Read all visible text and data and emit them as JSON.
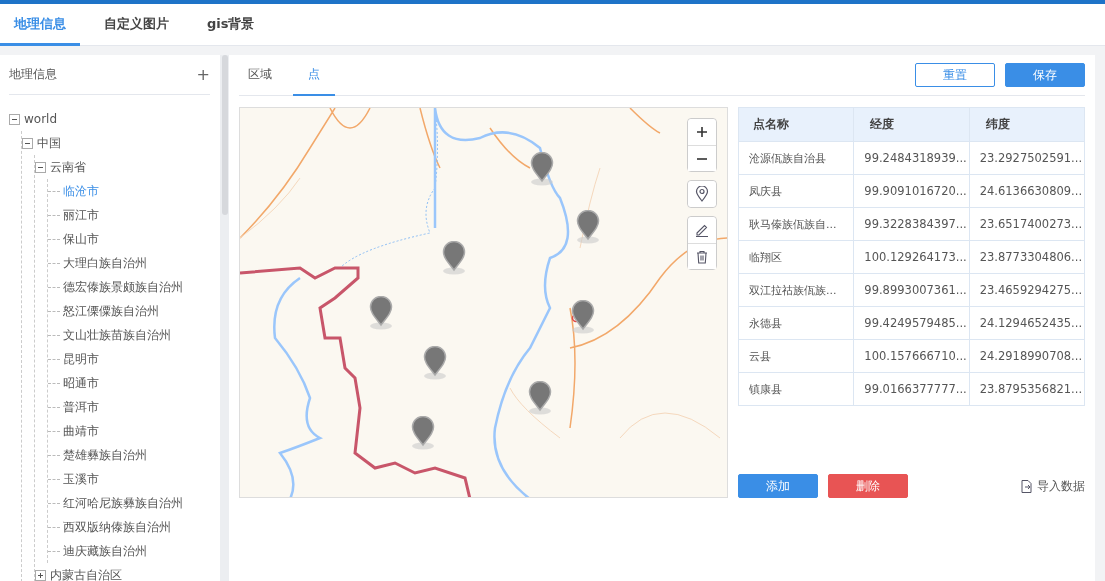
{
  "tabs": [
    {
      "label": "地理信息",
      "selected": true
    },
    {
      "label": "自定义图片",
      "selected": false
    },
    {
      "label": "gis背景",
      "selected": false
    }
  ],
  "sidebar": {
    "title": "地理信息",
    "add_icon": "+",
    "tree": [
      {
        "label": "world",
        "expanded": true,
        "selected": false,
        "children": [
          {
            "label": "中国",
            "expanded": true,
            "selected": false,
            "children": [
              {
                "label": "云南省",
                "expanded": true,
                "selected": false,
                "children": [
                  {
                    "label": "临沧市",
                    "selected": true
                  },
                  {
                    "label": "丽江市",
                    "selected": false
                  },
                  {
                    "label": "保山市",
                    "selected": false
                  },
                  {
                    "label": "大理白族自治州",
                    "selected": false
                  },
                  {
                    "label": "德宏傣族景颇族自治州",
                    "selected": false
                  },
                  {
                    "label": "怒江傈僳族自治州",
                    "selected": false
                  },
                  {
                    "label": "文山壮族苗族自治州",
                    "selected": false
                  },
                  {
                    "label": "昆明市",
                    "selected": false
                  },
                  {
                    "label": "昭通市",
                    "selected": false
                  },
                  {
                    "label": "普洱市",
                    "selected": false
                  },
                  {
                    "label": "曲靖市",
                    "selected": false
                  },
                  {
                    "label": "楚雄彝族自治州",
                    "selected": false
                  },
                  {
                    "label": "玉溪市",
                    "selected": false
                  },
                  {
                    "label": "红河哈尼族彝族自治州",
                    "selected": false
                  },
                  {
                    "label": "西双版纳傣族自治州",
                    "selected": false
                  },
                  {
                    "label": "迪庆藏族自治州",
                    "selected": false
                  }
                ]
              },
              {
                "label": "内蒙古自治区",
                "expanded": false,
                "selected": false
              }
            ]
          }
        ]
      }
    ]
  },
  "subtabs": [
    {
      "label": "区域",
      "selected": false
    },
    {
      "label": "点",
      "selected": true
    }
  ],
  "actions": [
    {
      "label": "重置",
      "kind": "outline"
    },
    {
      "label": "保存",
      "kind": "primary"
    }
  ],
  "table": {
    "columns": [
      "点名称",
      "经度",
      "纬度"
    ],
    "rows": [
      [
        "沧源佤族自治县",
        "99.2484318939...",
        "23.2927502591..."
      ],
      [
        "凤庆县",
        "99.9091016720...",
        "24.6136630809..."
      ],
      [
        "耿马傣族佤族自...",
        "99.3228384397...",
        "23.6517400273..."
      ],
      [
        "临翔区",
        "100.129264173...",
        "23.8773304806..."
      ],
      [
        "双江拉祜族佤族...",
        "99.8993007361...",
        "23.4659294275..."
      ],
      [
        "永德县",
        "99.4249579485...",
        "24.1294652435..."
      ],
      [
        "云县",
        "100.157666710...",
        "24.2918990708..."
      ],
      [
        "镇康县",
        "99.0166377777...",
        "23.8795356821..."
      ]
    ]
  },
  "buttons": [
    {
      "label": "添加",
      "kind": "primary"
    },
    {
      "label": "删除",
      "kind": "danger"
    }
  ],
  "import_link": "导入数据"
}
